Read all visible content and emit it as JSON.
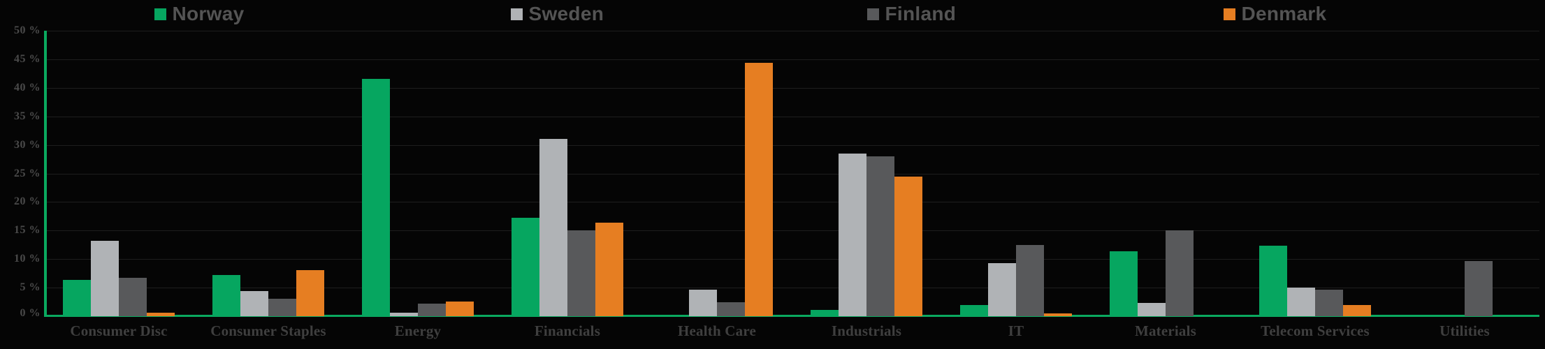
{
  "legend": {
    "position": "top-center",
    "entries": [
      {
        "label": "Norway",
        "color": "#06a660",
        "icon": "square-swatch-icon"
      },
      {
        "label": "Sweden",
        "color": "#b0b3b6",
        "icon": "square-swatch-icon"
      },
      {
        "label": "Finland",
        "color": "#58595b",
        "icon": "square-swatch-icon"
      },
      {
        "label": "Denmark",
        "color": "#e67e22",
        "icon": "square-swatch-icon"
      }
    ]
  },
  "axes": {
    "y_ticks": [
      "50 %",
      "45 %",
      "40 %",
      "35 %",
      "30 %",
      "25 %",
      "20 %",
      "15 %",
      "10 %",
      "5 %",
      "0 %"
    ],
    "y_tick_values": [
      50,
      45,
      40,
      35,
      30,
      25,
      20,
      15,
      10,
      5,
      0
    ],
    "x_ticks": [
      "Consumer Disc",
      "Consumer Staples",
      "Energy",
      "Financials",
      "Health Care",
      "Industrials",
      "IT",
      "Materials",
      "Telecom Services",
      "Utilities"
    ]
  },
  "chart_data": {
    "type": "bar",
    "title": "",
    "subtitle": "",
    "xlabel": "",
    "ylabel": "",
    "ylim": [
      0,
      50
    ],
    "ytick_step": 5,
    "grid": true,
    "legend_position": "top",
    "categories": [
      "Consumer Disc",
      "Consumer Staples",
      "Energy",
      "Financials",
      "Health Care",
      "Industrials",
      "IT",
      "Materials",
      "Telecom Services",
      "Utilities"
    ],
    "series": [
      {
        "name": "Norway",
        "color": "#06a660",
        "values": [
          6.4,
          7.2,
          41.6,
          17.3,
          0.0,
          1.1,
          1.9,
          11.4,
          12.4,
          0.0
        ]
      },
      {
        "name": "Sweden",
        "color": "#b0b3b6",
        "values": [
          13.2,
          4.4,
          0.6,
          31.0,
          4.6,
          28.5,
          9.3,
          2.3,
          5.0,
          0.0
        ]
      },
      {
        "name": "Finland",
        "color": "#58595b",
        "values": [
          6.7,
          3.0,
          2.2,
          15.0,
          2.5,
          28.0,
          12.5,
          15.0,
          4.6,
          9.6
        ]
      },
      {
        "name": "Denmark",
        "color": "#e67e22",
        "values": [
          0.6,
          8.1,
          2.6,
          16.4,
          44.4,
          24.4,
          0.5,
          0.0,
          1.9,
          0.0
        ]
      }
    ]
  },
  "colors": {
    "background": "#050505",
    "gridline": "#1e1e1e",
    "axis_accent": "#0aa95f",
    "tick_text": "#4a4a4a",
    "legend_text": "#545454"
  }
}
